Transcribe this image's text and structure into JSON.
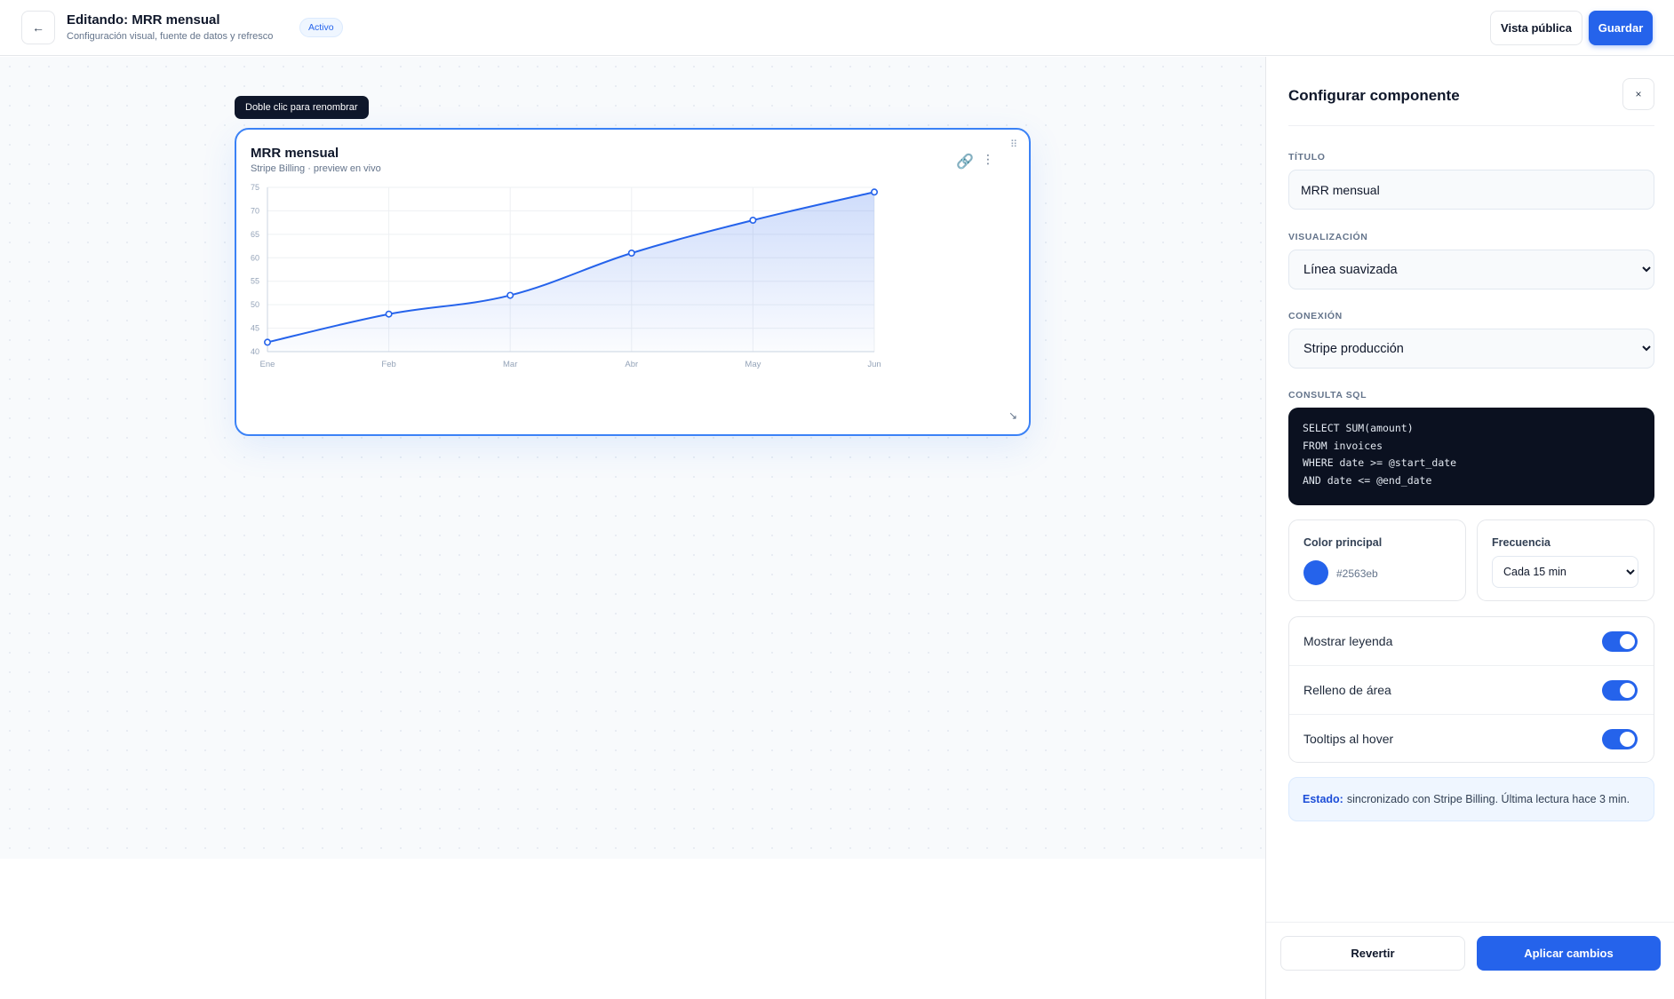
{
  "header": {
    "back_icon": "arrow-left-icon",
    "back_glyph": "←",
    "title": "Editando: MRR mensual",
    "subtitle": "Configuración visual, fuente de datos y refresco",
    "status": "Activo",
    "public_view_label": "Vista pública",
    "save_label": "Guardar"
  },
  "canvas": {
    "rename_tooltip": "Doble clic para renombrar",
    "widget": {
      "title": "MRR mensual",
      "subtitle": "Stripe Billing · preview en vivo",
      "link_icon": "link-icon",
      "link_glyph": "🔗",
      "more_icon": "more-vertical-icon",
      "more_glyph": "⋮",
      "drag_icon": "drag-handle-icon",
      "drag_glyph": "⠿",
      "resize_icon": "resize-handle-icon",
      "resize_glyph": "↘"
    }
  },
  "chart_data": {
    "type": "area",
    "categories": [
      "Ene",
      "Feb",
      "Mar",
      "Abr",
      "May",
      "Jun"
    ],
    "values": [
      42,
      48,
      52,
      61,
      68,
      74
    ],
    "yticks": [
      "40",
      "45",
      "50",
      "55",
      "60",
      "65",
      "70",
      "75"
    ],
    "ylim": [
      40,
      75
    ],
    "grid": true,
    "smooth": true,
    "line_color": "#2563eb",
    "fill_color": "#2563eb"
  },
  "panel": {
    "title": "Configurar componente",
    "close_glyph": "×",
    "title_label": "TÍTULO",
    "title_value": "MRR mensual",
    "viz_label": "VISUALIZACIÓN",
    "viz_value": "Línea suavizada",
    "conn_label": "CONEXIÓN",
    "conn_value": "Stripe producción",
    "sql_label": "CONSULTA SQL",
    "sql_lines": [
      "SELECT SUM(amount)",
      "FROM invoices",
      "WHERE date >= @start_date",
      "AND date <= @end_date"
    ],
    "color_label": "Color principal",
    "color_value": "#2563eb",
    "freq_label": "Frecuencia",
    "freq_value": "Cada 15 min",
    "toggles": [
      {
        "label": "Mostrar leyenda",
        "on": true
      },
      {
        "label": "Relleno de área",
        "on": true
      },
      {
        "label": "Tooltips al hover",
        "on": true
      }
    ],
    "status_key": "Estado:",
    "status_text": "sincronizado con Stripe Billing. Última lectura hace 3 min.",
    "revert_label": "Revertir",
    "apply_label": "Aplicar cambios"
  }
}
